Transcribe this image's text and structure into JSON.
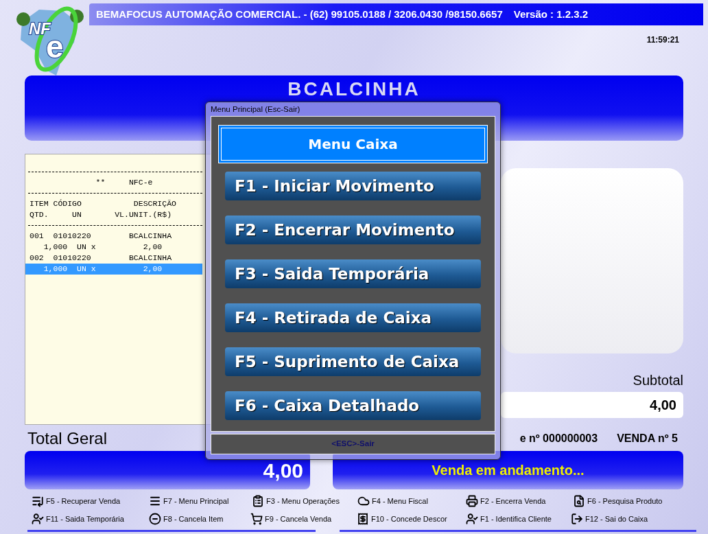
{
  "header": {
    "logo": [
      "NF",
      "e"
    ],
    "company": "BEMAFOCUS AUTOMAÇÃO COMERCIAL. - (62) 99105.0188  / 3206.0430 /98150.6657",
    "version": "Versão : 1.2.3.2",
    "time": "11:59:21"
  },
  "product_title": "BCALCINHA",
  "receipt": {
    "lines": [
      {
        "kind": "rule"
      },
      {
        "kind": "text",
        "text": "              **     NFC-e",
        "selected": false
      },
      {
        "kind": "rule"
      },
      {
        "kind": "text",
        "text": "ITEM CÓDIGO           DESCRIÇÃO",
        "selected": false
      },
      {
        "kind": "text",
        "text": "QTD.     UN       VL.UNIT.(R$)",
        "selected": false
      },
      {
        "kind": "rule"
      },
      {
        "kind": "text",
        "text": "001  01010220        BCALCINHA",
        "selected": false
      },
      {
        "kind": "text",
        "text": "   1,000  UN x          2,00",
        "selected": false
      },
      {
        "kind": "text",
        "text": "002  01010220        BCALCINHA",
        "selected": false
      },
      {
        "kind": "text",
        "text": "   1,000  UN x          2,00",
        "selected": true
      }
    ]
  },
  "subtotal": {
    "label": "Subtotal",
    "value": "4,00"
  },
  "total": {
    "label": "Total Geral",
    "value": "4,00"
  },
  "receipt_number": "e nº 000000003",
  "sale_number": "VENDA nº 5",
  "status": "Venda em andamento...",
  "shortcuts": [
    [
      {
        "label": "F5 - Recuperar Venda"
      },
      {
        "label": "F7 - Menu Principal"
      },
      {
        "label": "F3 - Menu Operações"
      },
      {
        "label": "F4 - Menu Fiscal"
      },
      {
        "label": "F2 - Encerra Venda"
      },
      {
        "label": "F6 - Pesquisa Produto"
      }
    ],
    [
      {
        "label": "F11 - Saida Temporária"
      },
      {
        "label": "F8 - Cancela Item"
      },
      {
        "label": "F9 - Cancela Venda"
      },
      {
        "label": "F10 - Concede Descor"
      },
      {
        "label": "F1 - Identifica Cliente"
      },
      {
        "label": "F12 - Sai do Caixa"
      }
    ]
  ],
  "dialog": {
    "title": "Menu Principal (Esc-Sair)",
    "heading": "Menu Caixa",
    "options": [
      "F1 - Iniciar Movimento",
      "F2 - Encerrar Movimento",
      "F3 - Saida Temporária",
      "F4 - Retirada de Caixa",
      "F5 - Suprimento de Caixa",
      "F6 - Caixa Detalhado"
    ],
    "footer": "<ESC>-Sair"
  }
}
